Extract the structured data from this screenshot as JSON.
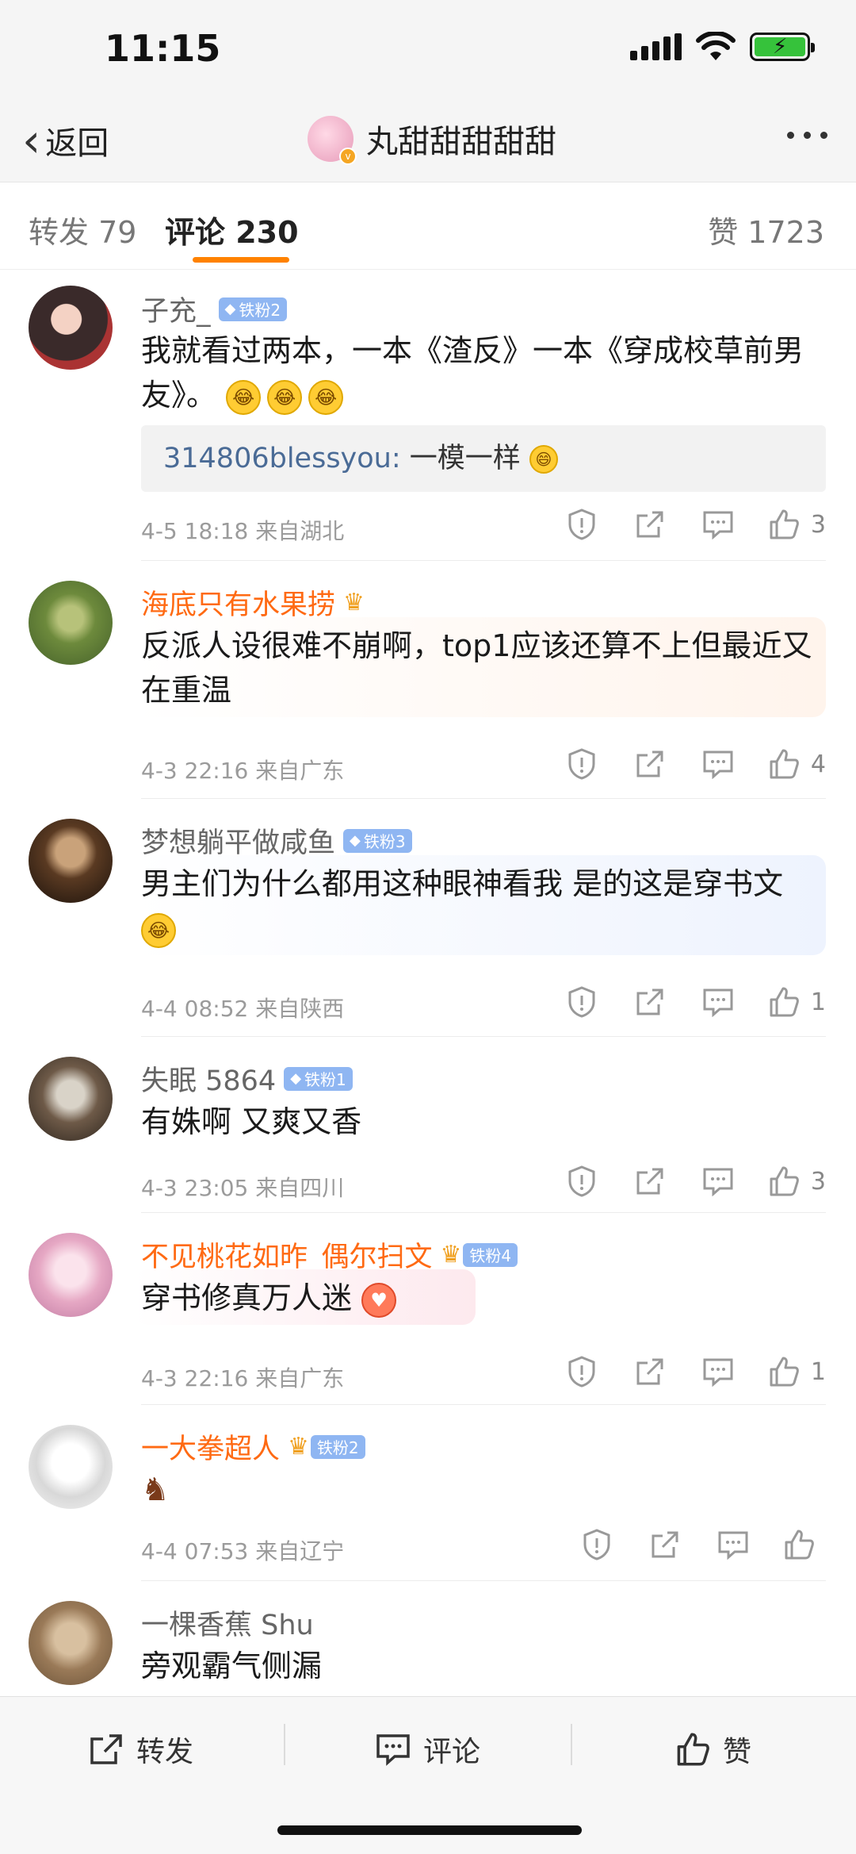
{
  "status": {
    "time": "11:15"
  },
  "nav": {
    "back_label": "返回",
    "title": "丸甜甜甜甜甜"
  },
  "tabs": {
    "repost": "转发 79",
    "comment": "评论 230",
    "like": "赞 1723"
  },
  "comments": [
    {
      "username": "子充_",
      "badge": "铁粉2",
      "name_color": "gray",
      "text": "我就看过两本，一本《渣反》一本《穿成校草前男友》。",
      "emojis": 3,
      "reply": {
        "user": "314806blessyou:",
        "text": " 一模一样"
      },
      "meta": "4-5 18:18  来自湖北",
      "likes": "3"
    },
    {
      "username": "海底只有水果捞",
      "badge": "",
      "name_color": "orange",
      "text": "反派人设很难不崩啊，top1应该还算不上但最近又在重温",
      "meta": "4-3 22:16  来自广东",
      "likes": "4"
    },
    {
      "username": "梦想躺平做咸鱼",
      "badge": "铁粉3",
      "name_color": "gray",
      "text": "男主们为什么都用这种眼神看我 是的这是穿书文",
      "meta": "4-4 08:52  来自陕西",
      "likes": "1"
    },
    {
      "username": "失眠 5864",
      "badge": "铁粉1",
      "name_color": "gray",
      "text": "有姝啊 又爽又香",
      "meta": "4-3 23:05  来自四川",
      "likes": "3"
    },
    {
      "username": "不见桃花如昨_偶尔扫文",
      "badge": "铁粉4",
      "name_color": "orange",
      "text": "穿书修真万人迷",
      "meta": "4-3 22:16  来自广东",
      "likes": "1"
    },
    {
      "username": "一大拳超人",
      "badge": "铁粉2",
      "name_color": "orange",
      "text": "",
      "meta": "4-4 07:53  来自辽宁",
      "likes": ""
    },
    {
      "username": "一棵香蕉 Shu",
      "badge": "",
      "name_color": "gray",
      "text": "旁观霸气侧漏",
      "meta": "",
      "likes": ""
    }
  ],
  "bottom_bar": {
    "repost": "转发",
    "comment": "评论",
    "like": "赞"
  },
  "colors": {
    "accent": "#ff8200",
    "orange_name": "#ff6a13",
    "badge_blue": "#8fb6f2"
  }
}
